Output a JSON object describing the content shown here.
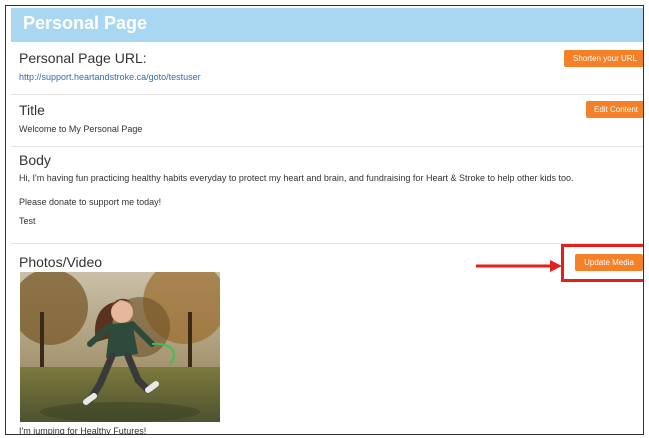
{
  "header": {
    "title": "Personal Page"
  },
  "url_section": {
    "title": "Personal Page URL:",
    "url": "http://support.heartandstroke.ca/goto/testuser",
    "button": "Shorten your URL"
  },
  "title_section": {
    "title": "Title",
    "value": "Welcome to My Personal Page",
    "button": "Edit Content"
  },
  "body_section": {
    "title": "Body",
    "paragraph1": "Hi, I'm having fun practicing healthy habits everyday to protect my heart and brain, and fundraising for Heart & Stroke to help other kids too.",
    "paragraph2": "Please donate to support me today!",
    "paragraph3": "Test"
  },
  "media_section": {
    "title": "Photos/Video",
    "button": "Update Media",
    "caption": "I'm jumping for Healthy Futures!"
  },
  "colors": {
    "header": "#a9d6f1",
    "button": "#f48028",
    "annotation": "#e2211c"
  }
}
